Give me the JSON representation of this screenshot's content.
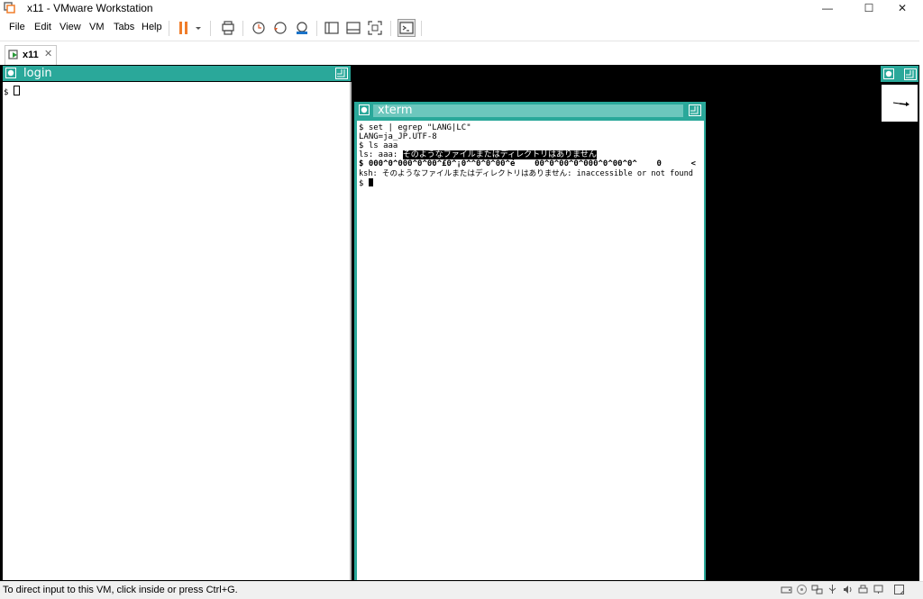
{
  "window": {
    "title": "x11 - VMware Workstation",
    "minimize": "—",
    "maximize": "☐",
    "close": "✕"
  },
  "menu": [
    "File",
    "Edit",
    "View",
    "VM",
    "Tabs",
    "Help"
  ],
  "tab": {
    "label": "x11",
    "close": "✕"
  },
  "login": {
    "title": "login",
    "prompt": "$ "
  },
  "xterm": {
    "title": "xterm",
    "lines": [
      "$ set | egrep \"LANG|LC\"",
      "LANG=ja_JP.UTF-8",
      "$ ls aaa",
      "$ 000^0^000^0^00^£0^¡0^^0^0^00^é    00^0^00^0^000^0^00^0^    0      <",
      "ksh: そのようなファイルまたはディレクトリはありません: inaccessible or not found",
      "$ "
    ],
    "ls_prefix": "ls: aaa: ",
    "ls_error": "そのようなファイルまたはディレクトリはありません"
  },
  "status": {
    "text": "To direct input to this VM, click inside or press Ctrl+G."
  },
  "colors": {
    "titlebar_teal": "#2aa89a",
    "titlebar_light": "#6cc7bd",
    "pause_orange": "#f07d2a"
  },
  "icons": [
    "vmware-logo-icon",
    "pause-icon",
    "send-ctrl-alt-del-icon",
    "snapshot-icon",
    "revert-snapshot-icon",
    "snapshot-manager-icon",
    "library-icon",
    "thumbnail-bar-icon",
    "fullscreen-icon",
    "console-view-icon"
  ]
}
